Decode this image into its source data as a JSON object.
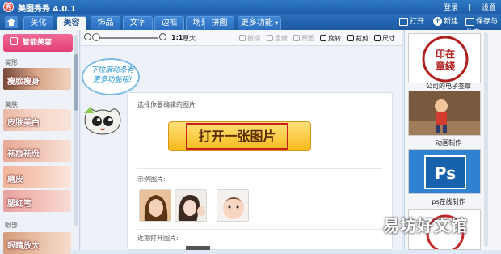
{
  "app": {
    "title": "美图秀秀 4.0.1",
    "logo_glyph": "秀"
  },
  "titlebar": {
    "login": "登录",
    "settings": "设置",
    "divider": "|"
  },
  "tabs": [
    {
      "label": "美化"
    },
    {
      "label": "美容"
    },
    {
      "label": "饰品"
    },
    {
      "label": "文字"
    },
    {
      "label": "边框"
    },
    {
      "label": "场景"
    },
    {
      "label": "拼图"
    },
    {
      "label": "更多功能"
    }
  ],
  "actions": {
    "open": "打开",
    "new": "新建",
    "save_share": "保存与分享",
    "new_glyph": "+"
  },
  "left": {
    "ai_button": "智能美容",
    "section_shape": "美形",
    "slim": "瘦脸瘦身",
    "section_skin": "美肤",
    "whiten": "皮肤美白",
    "acne": "祛痘祛斑",
    "soften": "磨皮",
    "blush": "腮红笔",
    "section_eye": "眼部",
    "eye_enlarge": "眼睛放大"
  },
  "toolbar": {
    "ratio": "1:1",
    "original": "原大",
    "undo": "撤销",
    "redo": "重做",
    "original_image": "原图",
    "rotate": "旋转",
    "crop": "裁剪",
    "size": "尺寸"
  },
  "bubble": {
    "text": "下拉滚动条有更多功能哦!"
  },
  "card": {
    "select_label": "选择你要编辑的图片",
    "open_button": "打开一张图片",
    "samples_label": "示例图片:",
    "recent_label": "近期打开图片:"
  },
  "right": {
    "items": [
      {
        "caption": "公司的电子签章",
        "stamp_text": "印在章綫"
      },
      {
        "caption": "动画制作"
      },
      {
        "caption": "ps在线制作",
        "ps_text": "Ps"
      }
    ]
  },
  "watermark": "易坊好文馆",
  "colors": {
    "accent": "#2a6fbb",
    "pink": "#e13f74",
    "yellow": "#f7b91b",
    "red": "#cc1e1e"
  }
}
